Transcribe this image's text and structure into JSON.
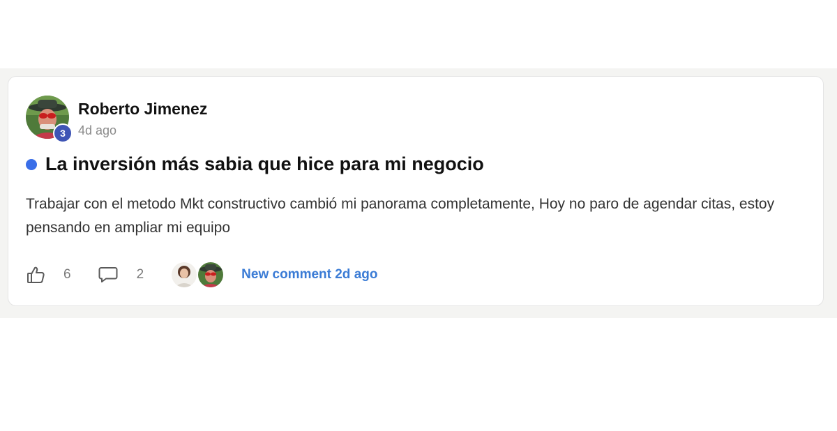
{
  "post": {
    "author": {
      "name": "Roberto Jimenez",
      "level": "3",
      "avatar_icon": "user-avatar-photo"
    },
    "time": "4d ago",
    "title": "La inversión más sabia que hice para mi negocio",
    "unread_color": "#3a6ee8",
    "body": "Trabajar con el metodo Mkt constructivo cambió mi panorama completamente, Hoy no paro de agendar citas, estoy pensando en ampliar mi equipo",
    "likes": "6",
    "comments": "2",
    "last_comment": "New comment 2d ago"
  },
  "colors": {
    "accent": "#3a7bd5",
    "level_badge": "#3f55b5"
  }
}
